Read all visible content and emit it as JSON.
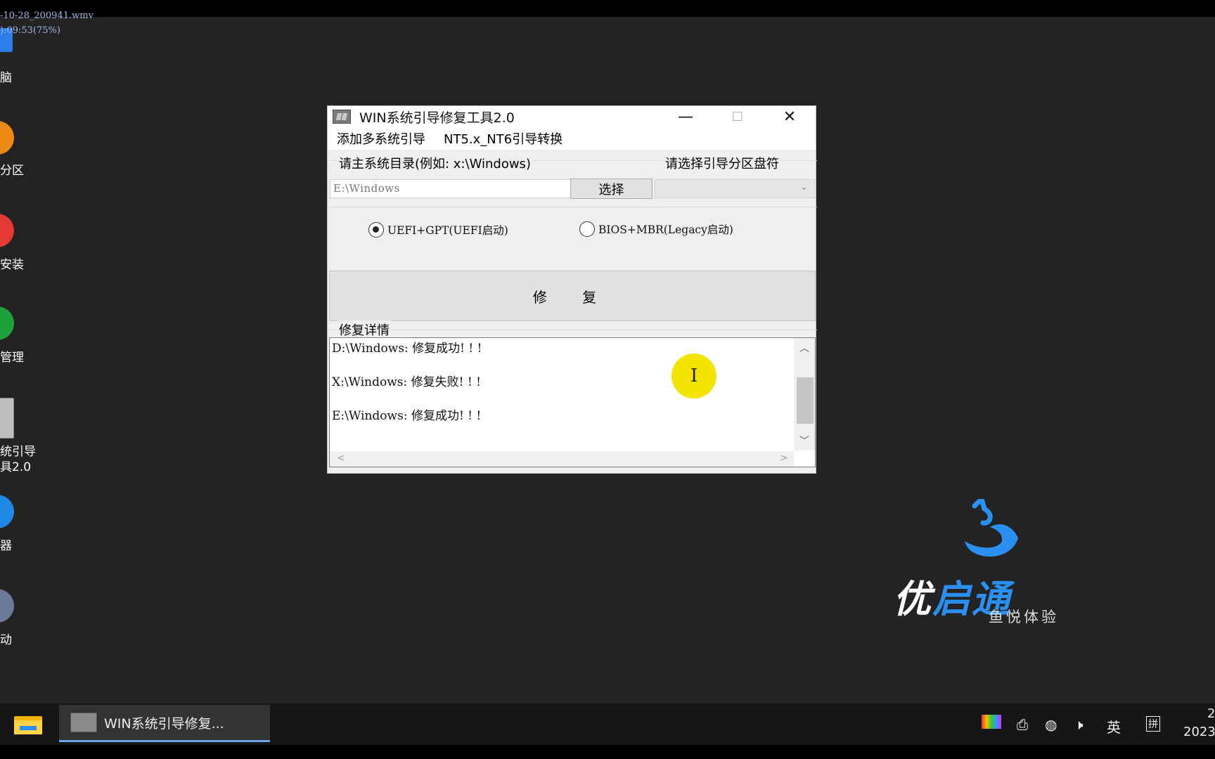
{
  "video_overlay": {
    "filename": "-10-28_200941.wmv",
    "timecode": "):09:53(75%)"
  },
  "desktop_icons": [
    {
      "label": "脑",
      "color": "#2b7de9"
    },
    {
      "label": "分区",
      "color": "#f08a17"
    },
    {
      "label": "安装",
      "color": "#e53935"
    },
    {
      "label": "管理",
      "color": "#1ea13a"
    },
    {
      "label": "统引导",
      "label2": "具2.0",
      "color": "#bdbdbd"
    },
    {
      "label": "器",
      "color": "#1e88e5"
    },
    {
      "label": "动",
      "color": "#6b7a99"
    }
  ],
  "window": {
    "title": "WIN系统引导修复工具2.0",
    "controls": {
      "minimize": "—",
      "maximize": "☐",
      "close": "✕"
    },
    "menu": [
      "添加多系统引导",
      "NT5.x_NT6引导转换"
    ],
    "dir_group_label": "请主系统目录(例如: x:\\Windows)",
    "drive_group_label": "请选择引导分区盘符",
    "path_value": "E:\\Windows",
    "select_button": "选择",
    "drive_select_value": "",
    "radio_uefi": {
      "label": "UEFI+GPT(UEFI启动)",
      "checked": true
    },
    "radio_bios": {
      "label": "BIOS+MBR(Legacy启动)",
      "checked": false
    },
    "repair_button": "修 复",
    "log_group_label": "修复详情",
    "log_lines": [
      "D:\\Windows: 修复成功! ! !",
      "X:\\Windows: 修复失败! ! !",
      "E:\\Windows: 修复成功! ! !"
    ]
  },
  "brand": {
    "name_part1": "优",
    "name_part2": "启通",
    "tagline": "鱼悦体验",
    "color": "#2a8ff0"
  },
  "taskbar": {
    "app_label": "WIN系统引导修复...",
    "ime_label": "英",
    "ime_mode": "拼",
    "clock_line1": "2",
    "clock_line2": "2023"
  }
}
